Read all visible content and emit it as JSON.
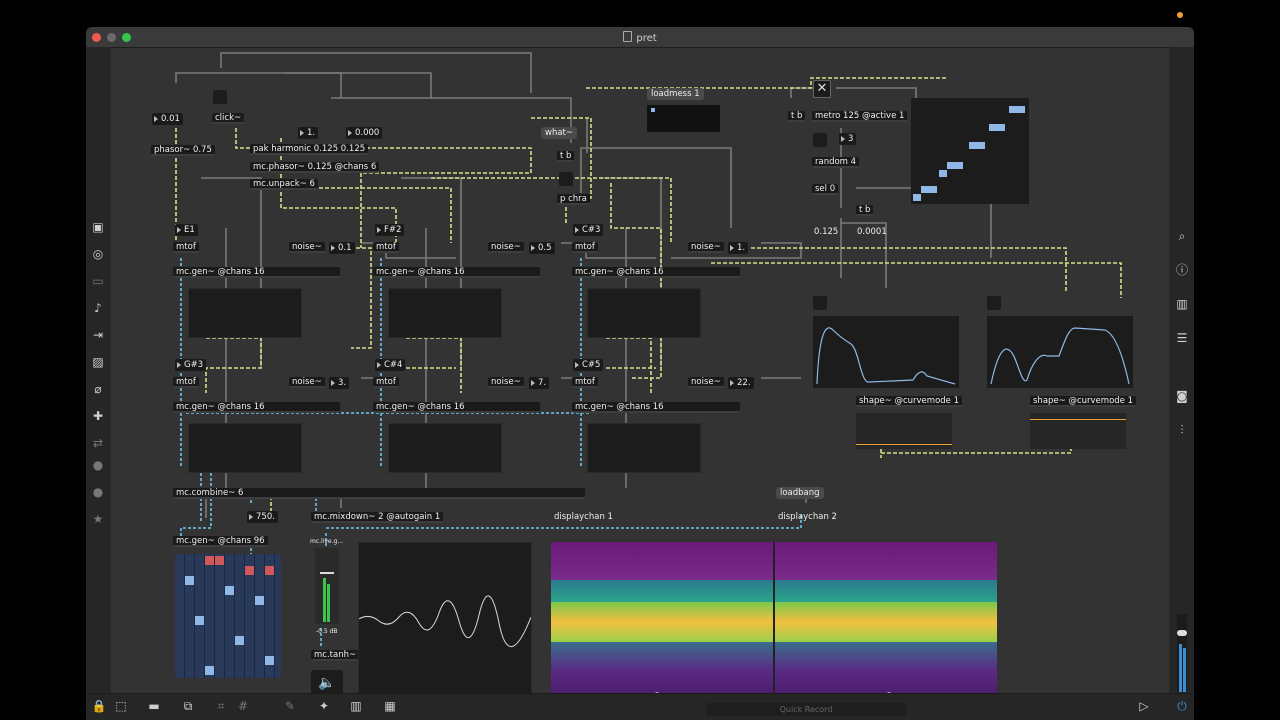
{
  "window": {
    "title": "pret"
  },
  "colors": {
    "accent_blue": "#8fb8e6",
    "yellow_cable": "#d7e08a",
    "blue_cable": "#6ec6ec",
    "orange": "#f0a030"
  },
  "left_toolbar": [
    "package-icon",
    "target-icon",
    "divider-icon",
    "music-note-icon",
    "step-icon",
    "image-icon",
    "paperclip-icon",
    "puzzle-icon",
    "repeat-icon",
    "circle-v-icon",
    "circle-b-icon",
    "star-icon"
  ],
  "right_toolbar": [
    "search-icon",
    "info-icon",
    "book-icon",
    "list-icon",
    "camera-icon",
    "sliders-icon"
  ],
  "bottom_toolbar": [
    "lock-icon",
    "edit-icon",
    "comment-icon",
    "windows-icon",
    "message-icon",
    "grid-icon",
    "pin-icon",
    "wrench-icon",
    "piano-icon",
    "keyboard-icon"
  ],
  "quick_record": "Quick Record",
  "objects": {
    "num_001": "0.01",
    "click": "click~",
    "phasor": "phasor~ 0.75",
    "num_1": "1.",
    "num_000": "0.000",
    "pak": "pak harmonic 0.125 0.125",
    "mcphasor": "mc.phasor~ 0.125 @chans 6",
    "unpack": "mc.unpack~ 6",
    "what": "what~",
    "tb1": "t b",
    "pchra": "p chra",
    "loadmess": "loadmess 1",
    "tb2": "t b",
    "metro": "metro 125 @active 1",
    "num_3": "3",
    "random": "random 4",
    "sel": "sel 0",
    "tb3": "t b",
    "f0125": "0.125",
    "f00001": "0.0001",
    "e1": "E1",
    "f2": "F#2",
    "c3": "C#3",
    "mtof": "mtof",
    "noise": "noise~",
    "n01": "0.1",
    "n05": "0.5",
    "n1": "1.",
    "gen": "mc.gen~ @chans 16",
    "g3": "G#3",
    "c4": "C#4",
    "c5": "C#5",
    "n3": "3.",
    "n7": "7.",
    "n22": "22.",
    "shape": "shape~ @curvemode 1",
    "combine": "mc.combine~ 6",
    "n750": "750.",
    "mixdown": "mc.mixdown~ 2 @autogain 1",
    "disp1": "displaychan 1",
    "loadbang": "loadbang",
    "disp2": "displaychan 2",
    "gen96": "mc.gen~ @chans 96",
    "live": "mc.live.g...",
    "db": "-0.5 dB",
    "tanh": "mc.tanh~"
  }
}
